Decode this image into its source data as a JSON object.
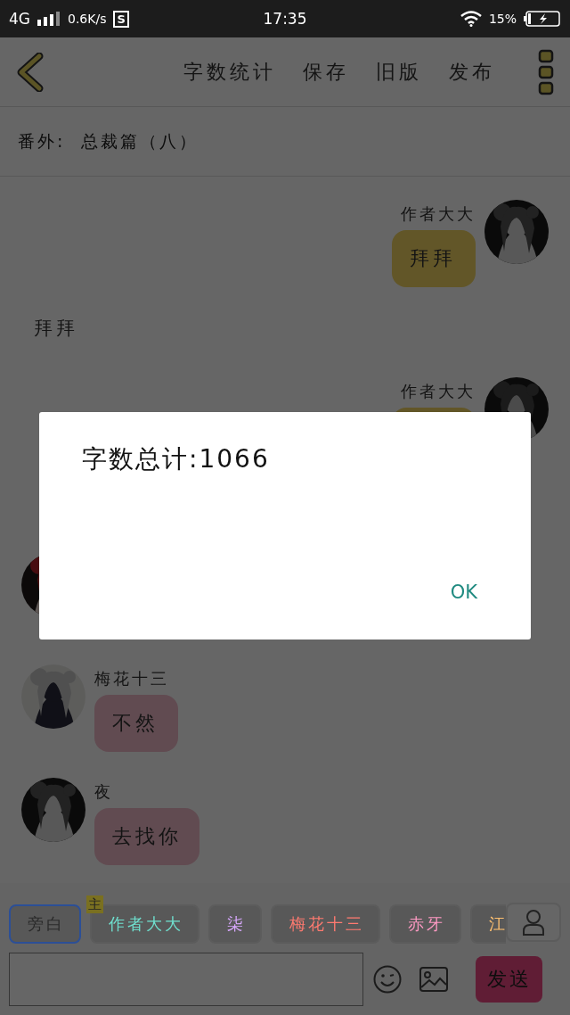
{
  "status_bar": {
    "network": "4G",
    "speed": "0.6K/s",
    "app_badge": "S",
    "time": "17:35",
    "battery": "15%"
  },
  "toolbar": {
    "actions": [
      "字数统计",
      "保存",
      "旧版",
      "发布"
    ]
  },
  "chapter_title": "番外:  总裁篇（八）",
  "messages": [
    {
      "kind": "outgoing",
      "sender": "作者大大",
      "text": "拜拜"
    },
    {
      "kind": "narration",
      "text": "拜拜"
    },
    {
      "kind": "outgoing",
      "sender": "作者大大"
    },
    {
      "kind": "incoming"
    },
    {
      "kind": "incoming",
      "sender": "梅花十三",
      "text": "不然"
    },
    {
      "kind": "incoming",
      "sender": "夜",
      "text": "去找你"
    }
  ],
  "roles": [
    {
      "name": "旁白",
      "selected": true,
      "color": "#2a2a2a"
    },
    {
      "name": "作者大大",
      "selected": false,
      "color": "#6fe0cf",
      "badge": "主"
    },
    {
      "name": "柒",
      "selected": false,
      "color": "#d9a8ff"
    },
    {
      "name": "梅花十三",
      "selected": false,
      "color": "#ff7a70"
    },
    {
      "name": "赤牙",
      "selected": false,
      "color": "#ff9ac4"
    },
    {
      "name": "江",
      "selected": false,
      "color": "#ffc070"
    }
  ],
  "composer": {
    "send": "发送"
  },
  "dialog": {
    "message": "字数总计:1066",
    "button": "OK"
  }
}
